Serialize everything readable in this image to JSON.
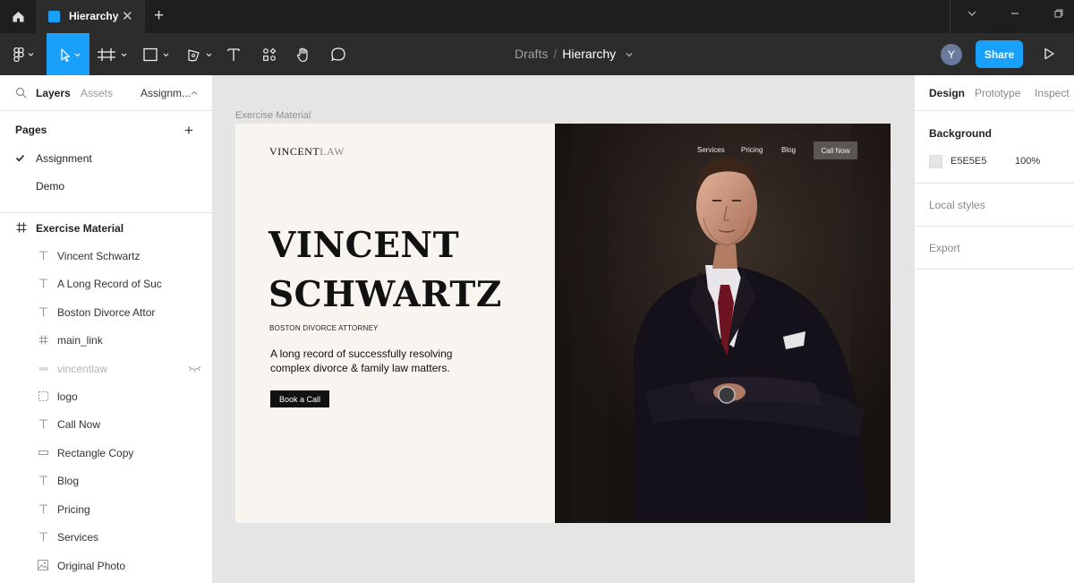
{
  "tabbar": {
    "tab_title": "Hierarchy",
    "close_glyph": "✕",
    "add_glyph": "+"
  },
  "toolbar": {
    "breadcrumb_drafts": "Drafts",
    "breadcrumb_sep": "/",
    "breadcrumb_file": "Hierarchy",
    "avatar_initial": "Y",
    "share_label": "Share",
    "accent": "#18a0fb"
  },
  "left_panel": {
    "tabs": [
      "Layers",
      "Assets",
      "Assignm..."
    ],
    "pages_title": "Pages",
    "pages": [
      {
        "label": "Assignment",
        "selected": true
      },
      {
        "label": "Demo",
        "selected": false
      }
    ],
    "frame_name": "Exercise Material",
    "layers": [
      {
        "label": "Vincent Schwartz",
        "icon": "text-icon"
      },
      {
        "label": "A Long Record of Suc",
        "icon": "text-icon"
      },
      {
        "label": "Boston Divorce Attor",
        "icon": "text-icon"
      },
      {
        "label": "main_link",
        "icon": "frame-icon"
      },
      {
        "label": "vincentlaw",
        "icon": "image-icon",
        "hidden": true
      },
      {
        "label": "logo",
        "icon": "group-icon"
      },
      {
        "label": "Call Now",
        "icon": "text-icon"
      },
      {
        "label": "Rectangle Copy",
        "icon": "rectangle-icon"
      },
      {
        "label": "Blog",
        "icon": "text-icon"
      },
      {
        "label": "Pricing",
        "icon": "text-icon"
      },
      {
        "label": "Services",
        "icon": "text-icon"
      },
      {
        "label": "Original Photo",
        "icon": "image-icon"
      }
    ]
  },
  "canvas": {
    "frame_label": "Exercise Material",
    "logo_main": "VINCENT",
    "logo_suffix": "LAW",
    "name_line1": "VINCENT",
    "name_line2": "SCHWARTZ",
    "subtitle": "BOSTON DIVORCE ATTORNEY",
    "lead": "A long record of successfully resolving complex divorce & family law matters.",
    "cta": "Book a Call",
    "nav": [
      "Services",
      "Pricing",
      "Blog"
    ],
    "nav_cta": "Call Now"
  },
  "right_panel": {
    "tabs": [
      "Design",
      "Prototype",
      "Inspect"
    ],
    "background_title": "Background",
    "background_hex": "E5E5E5",
    "background_opacity": "100%",
    "local_styles": "Local styles",
    "export": "Export"
  }
}
